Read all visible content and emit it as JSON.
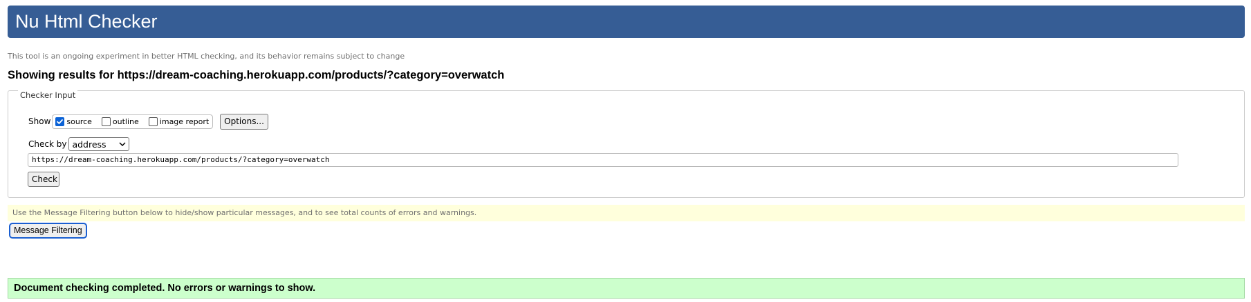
{
  "header": {
    "title": "Nu Html Checker"
  },
  "tagline": "This tool is an ongoing experiment in better HTML checking, and its behavior remains subject to change",
  "results_title": "Showing results for https://dream-coaching.herokuapp.com/products/?category=overwatch",
  "checker": {
    "legend": "Checker Input",
    "show_label": "Show",
    "options": [
      {
        "label": "source",
        "checked": true
      },
      {
        "label": "outline",
        "checked": false
      },
      {
        "label": "image report",
        "checked": false
      }
    ],
    "options_button": "Options...",
    "check_by_label": "Check by",
    "check_by_value": "address",
    "url_value": "https://dream-coaching.herokuapp.com/products/?category=overwatch",
    "check_button": "Check"
  },
  "filter_info": "Use the Message Filtering button below to hide/show particular messages, and to see total counts of errors and warnings.",
  "filter_button": "Message Filtering",
  "result_message": "Document checking completed. No errors or warnings to show.",
  "colors": {
    "header_bg": "#365d95",
    "info_bg": "#ffffdc",
    "success_bg": "#ccffcc",
    "focus_ring": "#1a5fd1"
  }
}
